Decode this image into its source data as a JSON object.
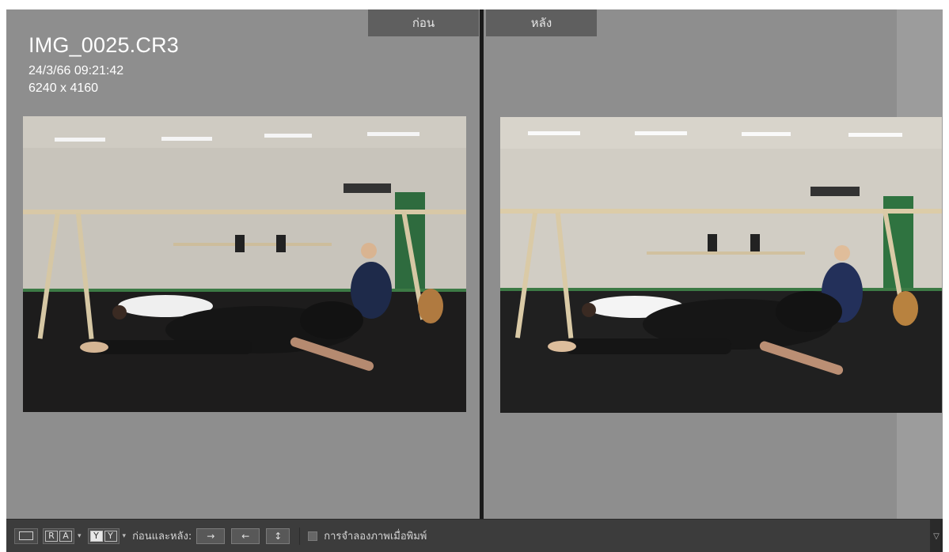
{
  "view_tabs": {
    "before": "ก่อน",
    "after": "หลัง"
  },
  "info": {
    "filename": "IMG_0025.CR3",
    "datetime": "24/3/66 09:21:42",
    "dimensions": "6240 x 4160"
  },
  "toolbar": {
    "ra_left": "R",
    "ra_right": "A",
    "yy_left": "Y",
    "yy_right": "Y",
    "before_after_label": "ก่อนและหลัง:",
    "swap_left": "→",
    "swap_right": "←",
    "swap_both": "↕",
    "softproof_label": "การจำลองภาพเมื่อพิมพ์",
    "collapse": "▽"
  },
  "colors": {
    "panel_bg": "#8c8c8c",
    "toolbar_bg": "#3c3c3c",
    "tab_bg": "#5f5f5f"
  },
  "icons": [
    "loupe-view-icon",
    "compare-ra-icon",
    "compare-yy-icon",
    "swap-before-after-icon",
    "copy-before-icon",
    "copy-after-icon",
    "collapse-panel-icon"
  ]
}
